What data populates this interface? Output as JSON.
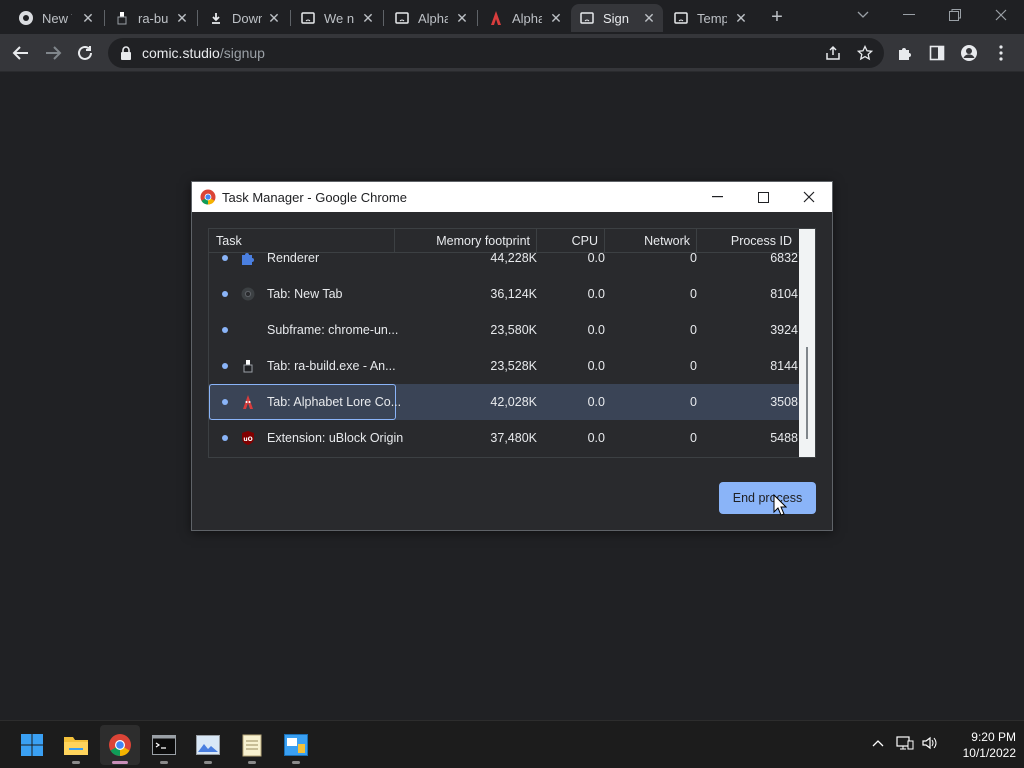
{
  "browser": {
    "tabs": [
      {
        "label": "New Tab",
        "icon": "chrome-icon"
      },
      {
        "label": "ra-build",
        "icon": "figure-icon"
      },
      {
        "label": "Downloads",
        "icon": "download-icon"
      },
      {
        "label": "We n",
        "icon": "sad-page-icon"
      },
      {
        "label": "Alpha",
        "icon": "sad-page-icon"
      },
      {
        "label": "Alpha",
        "icon": "alphabet-lore-icon"
      },
      {
        "label": "Sign",
        "icon": "sad-page-icon"
      },
      {
        "label": "Temp",
        "icon": "sad-page-icon"
      }
    ],
    "url_host": "comic.studio",
    "url_path": "/signup"
  },
  "task_manager": {
    "title": "Task Manager - Google Chrome",
    "columns": {
      "task": "Task",
      "memory": "Memory footprint",
      "cpu": "CPU",
      "network": "Network",
      "pid": "Process ID"
    },
    "rows": [
      {
        "task": "Renderer",
        "memory": "44,228K",
        "cpu": "0.0",
        "network": "0",
        "pid": "6832",
        "icon": "puzzle-icon"
      },
      {
        "task": "Tab: New Tab",
        "memory": "36,124K",
        "cpu": "0.0",
        "network": "0",
        "pid": "8104",
        "icon": "chrome-icon"
      },
      {
        "task": "Subframe: chrome-un...",
        "memory": "23,580K",
        "cpu": "0.0",
        "network": "0",
        "pid": "3924",
        "icon": ""
      },
      {
        "task": "Tab: ra-build.exe - An...",
        "memory": "23,528K",
        "cpu": "0.0",
        "network": "0",
        "pid": "8144",
        "icon": "figure-icon"
      },
      {
        "task": "Tab: Alphabet Lore Co...",
        "memory": "42,028K",
        "cpu": "0.0",
        "network": "0",
        "pid": "3508",
        "icon": "alphabet-lore-icon",
        "selected": true
      },
      {
        "task": "Extension: uBlock Origin",
        "memory": "37,480K",
        "cpu": "0.0",
        "network": "0",
        "pid": "5488",
        "icon": "ublock-icon"
      }
    ],
    "end_button": "End process"
  },
  "taskbar": {
    "apps": [
      "start-icon",
      "file-explorer-icon",
      "chrome-icon",
      "terminal-icon",
      "photos-icon",
      "notepad-icon",
      "control-panel-icon"
    ],
    "time": "9:20 PM",
    "date": "10/1/2022"
  }
}
